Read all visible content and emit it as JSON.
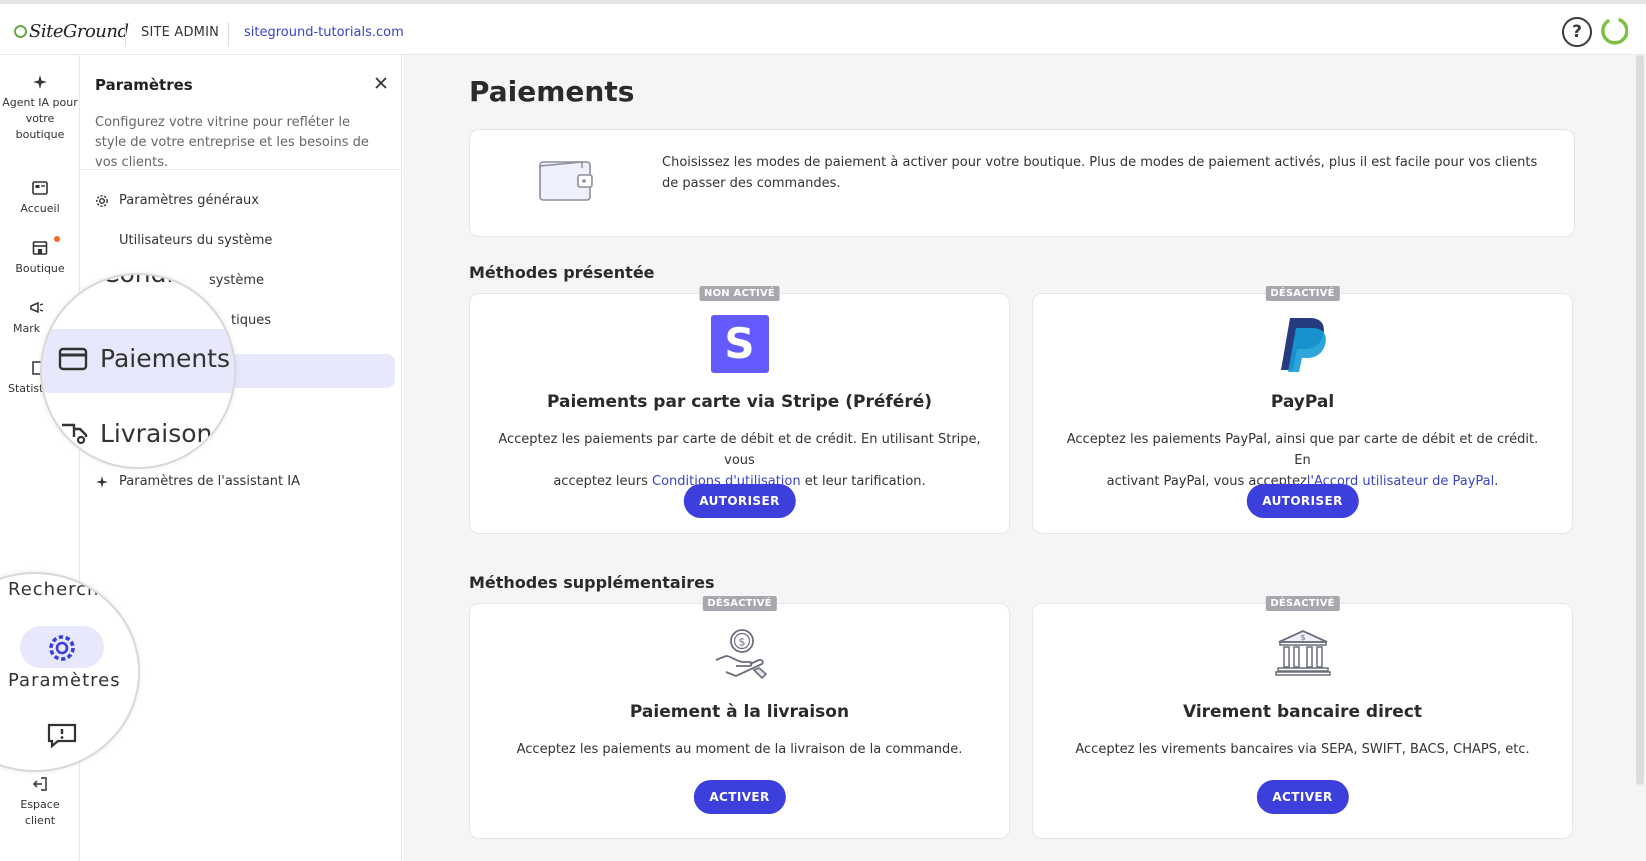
{
  "topbar": {
    "logo_text": "SiteGround",
    "section_label": "SITE ADMIN",
    "domain": "siteground-tutorials.com",
    "help_symbol": "?",
    "help_icon": "help-circle-icon",
    "loader_icon": "spinner-icon"
  },
  "rail": {
    "items": [
      {
        "label": "Agent IA pour votre boutique",
        "icon": "sparkle-icon"
      },
      {
        "label": "Accueil",
        "icon": "dashboard-icon"
      },
      {
        "label": "Boutique",
        "icon": "store-icon"
      },
      {
        "label": "Mark",
        "icon": "megaphone-icon"
      },
      {
        "label": "Statist",
        "icon": "chart-icon"
      },
      {
        "label": "Espace client",
        "icon": "exit-icon"
      }
    ],
    "notification_color": "#f16a2c"
  },
  "panel": {
    "title": "Paramètres",
    "description": "Configurez votre vitrine pour refléter le style de votre entreprise et les besoins de vos clients.",
    "items": [
      {
        "label": "Paramètres généraux",
        "icon": "gear-icon"
      },
      {
        "label": "Utilisateurs du système"
      },
      {
        "label": "système"
      },
      {
        "label": "tiques"
      },
      {
        "label": "Paramètres de l'assistant IA",
        "icon": "sparkle-icon"
      }
    ]
  },
  "magnifier_top": {
    "line1": "Condi",
    "active_label": "Paiements",
    "line3": "Livraison"
  },
  "magnifier_bottom": {
    "search_label": "Recherche",
    "settings_label": "Paramètres"
  },
  "main": {
    "title": "Paiements",
    "intro": "Choisissez les modes de paiement à activer pour votre boutique. Plus de modes de paiement activés, plus il est facile pour vos clients de passer des commandes.",
    "featured_title": "Méthodes présentée",
    "additional_title": "Méthodes supplémentaires",
    "featured": [
      {
        "badge": "NON ACTIVÉ",
        "logo_letter": "S",
        "title": "Paiements par carte via Stripe (Préféré)",
        "desc_line1": "Acceptez les paiements par carte de débit et de crédit. En utilisant Stripe, vous",
        "desc_pre": "acceptez leurs ",
        "desc_link": "Conditions d'utilisation",
        "desc_post": " et leur tarification.",
        "button": "AUTORISER"
      },
      {
        "badge": "DÉSACTIVÉ",
        "title": "PayPal",
        "desc_line1": "Acceptez les paiements PayPal, ainsi que par carte de débit et de crédit. En",
        "desc_pre": "activant PayPal, vous acceptez",
        "desc_link": "l'Accord utilisateur de PayPal",
        "desc_post": ".",
        "button": "AUTORISER"
      }
    ],
    "additional": [
      {
        "badge": "DÉSACTIVÉ",
        "title": "Paiement à la livraison",
        "desc": "Acceptez les paiements au moment de la livraison de la commande.",
        "button": "ACTIVER"
      },
      {
        "badge": "DÉSACTIVÉ",
        "title": "Virement bancaire direct",
        "desc": "Acceptez les virements bancaires via SEPA, SWIFT, BACS, CHAPS, etc.",
        "button": "ACTIVER"
      }
    ]
  },
  "colors": {
    "primary": "#3c3fdb",
    "link": "#3b43c6",
    "active_bg": "#e8e8fc",
    "stripe": "#635bff",
    "badge": "#a7a7ad"
  }
}
